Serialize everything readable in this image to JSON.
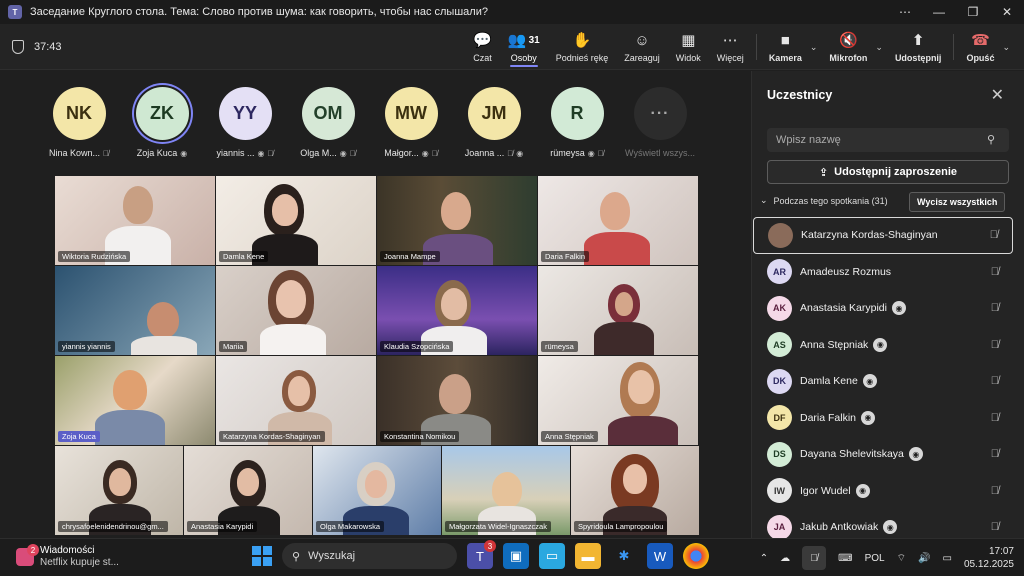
{
  "window": {
    "title": "Заседание Круглого стола. Тема: Слово против шума: как говорить, чтобы нас слышали?",
    "more": "⋯",
    "min": "—",
    "restore": "❐",
    "close": "✕"
  },
  "toolbar": {
    "timer": "37:43",
    "chat": "Czat",
    "people": "Osoby",
    "people_count": "31",
    "raise_hand": "Podnieś rękę",
    "react": "Zareaguj",
    "view": "Widok",
    "more": "Więcej",
    "camera": "Kamera",
    "mic": "Mikrofon",
    "share": "Udostępnij",
    "leave": "Opuść"
  },
  "avatars": [
    {
      "initials": "NK",
      "name": "Nina Kown..."
    },
    {
      "initials": "ZK",
      "name": "Zoja Kuca"
    },
    {
      "initials": "YY",
      "name": "yiannis ..."
    },
    {
      "initials": "OM",
      "name": "Olga M..."
    },
    {
      "initials": "MW",
      "name": "Małgor..."
    },
    {
      "initials": "JM",
      "name": "Joanna ..."
    },
    {
      "initials": "R",
      "name": "rümeysa"
    },
    {
      "initials": "···",
      "name": "Wyświetl wszys..."
    }
  ],
  "video_tiles": [
    [
      "Wiktoria Rudzińska",
      "Damla Kene",
      "Joanna Mampe",
      "Daria Falkin"
    ],
    [
      "yiannis yiannis",
      "Mariia",
      "Klaudia Szopcińska",
      "rümeysa"
    ],
    [
      "Zoja Kuca",
      "Katarzyna Kordas-Shaginyan",
      "Konstantina Nomikou",
      "Anna Stępniak"
    ],
    [
      "chrysafoelenidendrinou@gm...",
      "Anastasia Karypidi",
      "Olga Makarowska",
      "Małgorzata Widel-Ignaszczak",
      "Spyridoula Lampropoulou"
    ]
  ],
  "panel": {
    "title": "Uczestnicy",
    "search_placeholder": "Wpisz nazwę",
    "share_invite": "Udostępnij zaproszenie",
    "section": "Podczas tego spotkania (31)",
    "mute_all": "Wycisz wszystkich",
    "participants": [
      {
        "initials": "",
        "name": "Katarzyna Kordas-Shaginyan",
        "color": "#8a6b5a",
        "cam": false
      },
      {
        "initials": "AR",
        "name": "Amadeusz Rozmus",
        "color": "#dcd8f2",
        "cam": false
      },
      {
        "initials": "AK",
        "name": "Anastasia Karypidi",
        "color": "#f5d9e8",
        "cam": true
      },
      {
        "initials": "AS",
        "name": "Anna Stępniak",
        "color": "#d3ecd6",
        "cam": true
      },
      {
        "initials": "DK",
        "name": "Damla Kene",
        "color": "#dcd8f2",
        "cam": true
      },
      {
        "initials": "DF",
        "name": "Daria Falkin",
        "color": "#f3e6a8",
        "cam": true
      },
      {
        "initials": "DS",
        "name": "Dayana Shelevitskaya",
        "color": "#d3ecd6",
        "cam": true
      },
      {
        "initials": "IW",
        "name": "Igor Wudel",
        "color": "#e6e6e6",
        "cam": true
      },
      {
        "initials": "JA",
        "name": "Jakub Antkowiak",
        "color": "#f5d9e8",
        "cam": true
      }
    ]
  },
  "taskbar": {
    "notif_count": "2",
    "news_title": "Wiadomości",
    "news_sub": "Netflix kupuje st...",
    "search": "Wyszukaj",
    "teams_badge": "3",
    "lang": "POL",
    "time": "17:07",
    "date": "05.12.2025"
  }
}
